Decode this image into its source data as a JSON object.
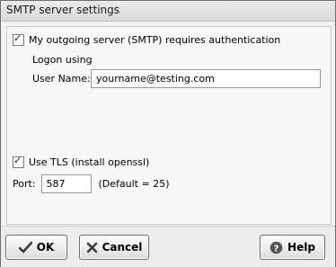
{
  "window": {
    "title": "SMTP server settings"
  },
  "auth": {
    "checkbox_label": "My outgoing server (SMTP) requires authentication",
    "checked": true,
    "logon_using_label": "Logon using",
    "username_label": "User Name:",
    "username_value": "yourname@testing.com"
  },
  "tls": {
    "checkbox_label": "Use TLS (install openssl)",
    "checked": true
  },
  "port": {
    "label": "Port:",
    "value": "587",
    "hint": "(Default = 25)"
  },
  "buttons": {
    "ok": "OK",
    "cancel": "Cancel",
    "help": "Help"
  },
  "colors": {
    "ok_icon": "#3a3a3a",
    "cancel_icon": "#3a3a3a",
    "help_icon": "#555555"
  },
  "icons": {
    "ok": "checkmark-icon",
    "cancel": "x-icon",
    "help": "question-icon"
  }
}
